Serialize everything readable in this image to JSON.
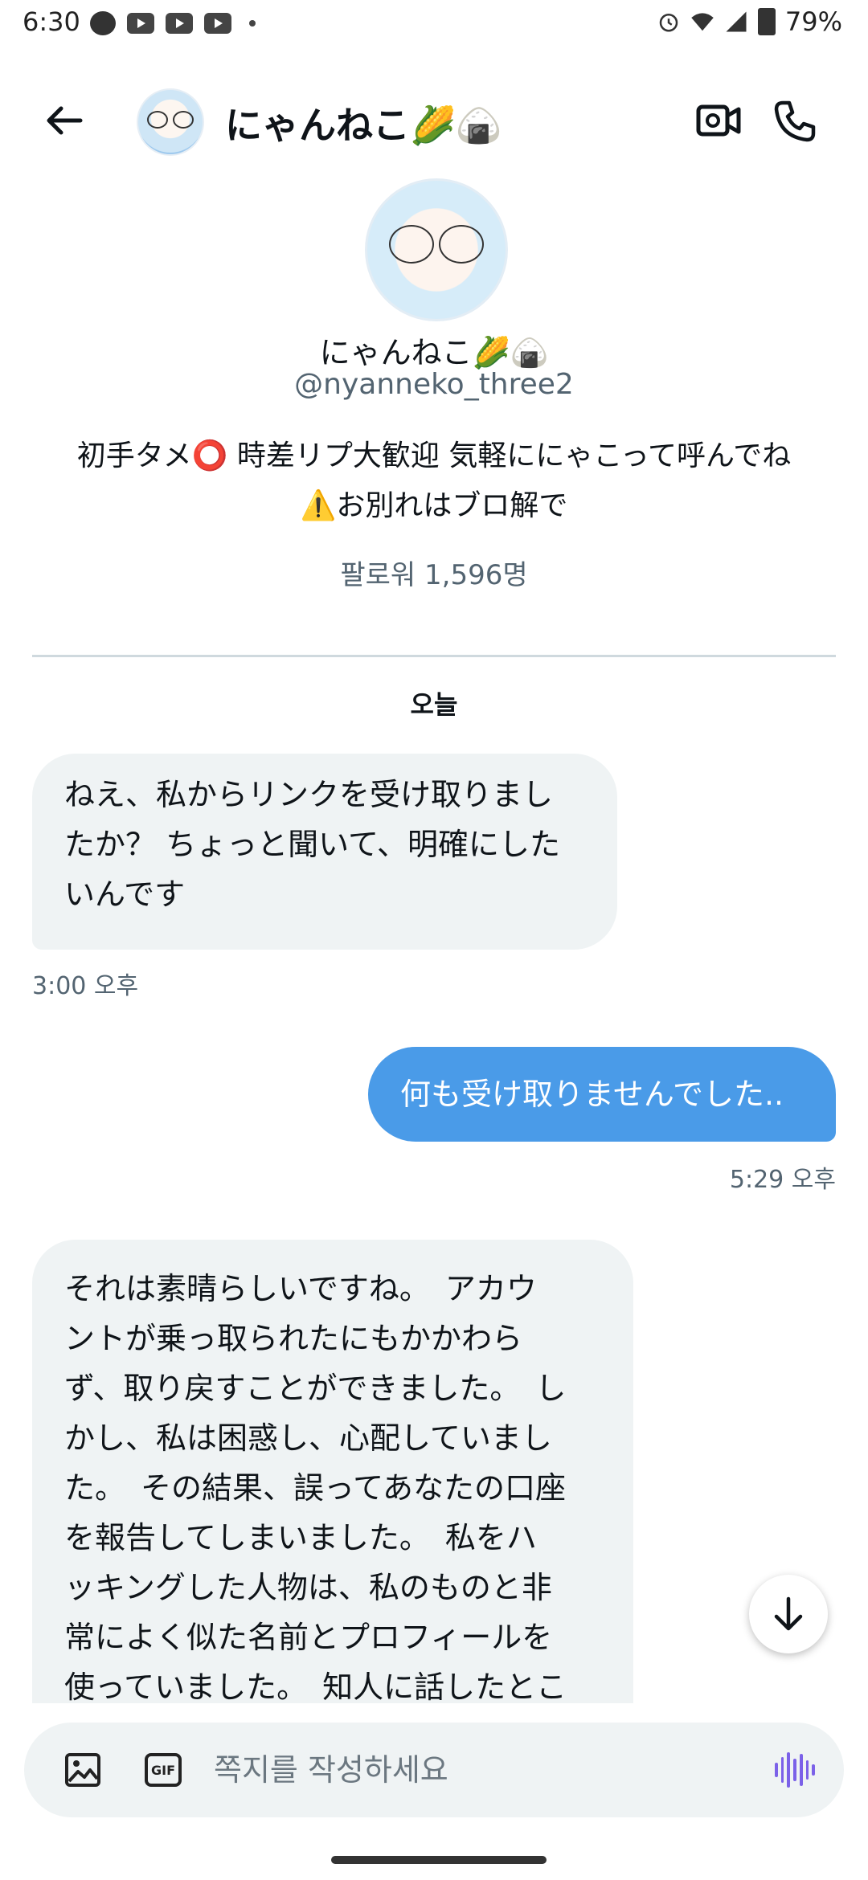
{
  "status_bar": {
    "time": "6:30",
    "battery": "79%",
    "icons": [
      "line-icon",
      "youtube-icon",
      "youtube-icon",
      "youtube-icon",
      "alarm-icon",
      "wifi-icon",
      "signal-icon",
      "battery-icon"
    ]
  },
  "header": {
    "title": "にゃんねこ🌽🍙"
  },
  "profile": {
    "name": "にゃんねこ🌽🍙",
    "handle": "@nyanneko_three2",
    "bio_line1": "初手タメ⭕ 時差リプ大歓迎 気軽ににゃこって呼んでね",
    "bio_line2": "⚠️お別れはブロ解で",
    "followers": "팔로워 1,596명"
  },
  "conversation": {
    "date_label": "오늘",
    "messages": [
      {
        "direction": "in",
        "text": "ねえ、私からリンクを受け取りまし\nたか？ ちょっと聞いて、明確にした\nいんです",
        "time": "3:00 오후"
      },
      {
        "direction": "out",
        "text": "何も受け取りませんでした..",
        "time": "5:29 오후"
      },
      {
        "direction": "in",
        "text": "それは素晴らしいですね。　アカウ\nントが乗っ取られたにもかかわら\nず、取り戻すことができました。　し\nかし、私は困惑し、心配していまし\nた。　その結果、誤ってあなたの口座\nを報告してしまいました。　私をハ\nッキングした人物は、私のものと非\n常によく似た名前とプロフィールを\n使っていました。　知人に話したとこ"
      }
    ]
  },
  "composer": {
    "placeholder": "쪽지를 작성하세요",
    "gif_label": "GIF"
  },
  "colors": {
    "accent": "#4a9be8",
    "incoming_bubble": "#eff3f4",
    "secondary_text": "#536471",
    "voice_icon": "#7b61e8"
  }
}
